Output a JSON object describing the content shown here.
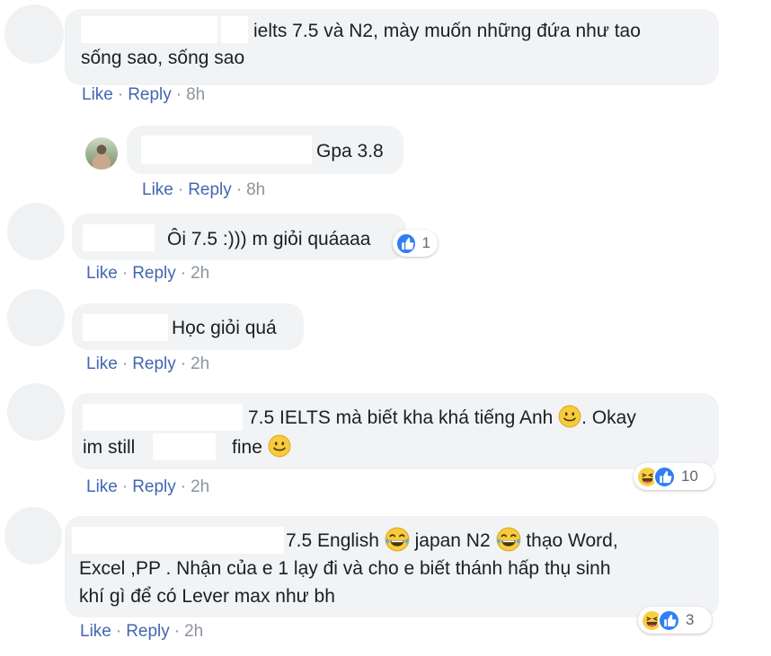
{
  "comments": [
    {
      "lines": [
        "ielts 7.5 và N2, mày muốn những đứa như tao",
        "sống sao, sống sao"
      ],
      "actions": {
        "like": "Like",
        "reply": "Reply",
        "time": "8h"
      }
    },
    {
      "lines": [
        "Gpa 3.8"
      ],
      "actions": {
        "like": "Like",
        "reply": "Reply",
        "time": "8h"
      }
    },
    {
      "lines": [
        "Ôi 7.5 :))) m giỏi quáaaa"
      ],
      "actions": {
        "like": "Like",
        "reply": "Reply",
        "time": "2h"
      },
      "reactions": {
        "count": "1",
        "icons": [
          "like-icon"
        ]
      }
    },
    {
      "lines": [
        "Học giỏi quá"
      ],
      "actions": {
        "like": "Like",
        "reply": "Reply",
        "time": "2h"
      }
    },
    {
      "segments": {
        "a": "7.5 IELTS mà biết kha khá tiếng Anh",
        "b": ". Okay",
        "c": "im still",
        "d": "fine"
      },
      "emojis": [
        "smile-emoji",
        "smile-emoji"
      ],
      "actions": {
        "like": "Like",
        "reply": "Reply",
        "time": "2h"
      },
      "reactions": {
        "count": "10",
        "icons": [
          "haha-icon",
          "like-icon"
        ]
      }
    },
    {
      "segments": {
        "a": "7.5 English",
        "b": "japan N2",
        "c": "thạo Word,",
        "line2": "Excel ,PP . Nhận của e 1 lạy đi và cho e biết thánh hấp thụ sinh",
        "line3": "khí gì để có Lever max như bh"
      },
      "emojis": [
        "laughing-tears-emoji",
        "laughing-tears-emoji"
      ],
      "actions": {
        "like": "Like",
        "reply": "Reply",
        "time": "2h"
      },
      "reactions": {
        "count": "3",
        "icons": [
          "haha-icon",
          "like-icon"
        ]
      }
    }
  ],
  "colors": {
    "link": "#4267b2",
    "bubble": "#f2f3f5",
    "like": "#2f7ef5",
    "haha": "#f7d046"
  }
}
